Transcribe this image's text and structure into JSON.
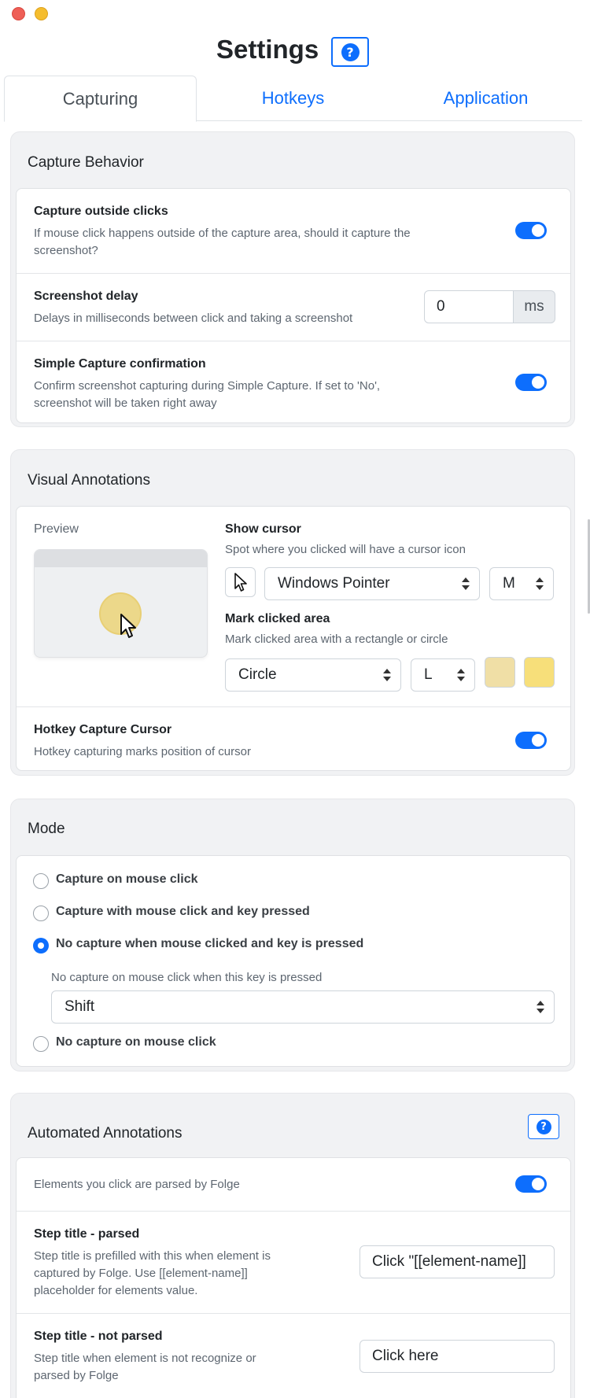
{
  "window": {
    "title": "Settings"
  },
  "tabs": [
    {
      "label": "Capturing",
      "active": true
    },
    {
      "label": "Hotkeys",
      "active": false
    },
    {
      "label": "Application",
      "active": false
    }
  ],
  "help_icon_glyph": "?",
  "capture_behavior": {
    "title": "Capture Behavior",
    "outside_clicks": {
      "title": "Capture outside clicks",
      "desc_line1": "If mouse click happens outside of the capture area, should it capture the",
      "desc_line2": "screenshot?",
      "enabled": true
    },
    "delay": {
      "title": "Screenshot delay",
      "desc": "Delays in milliseconds between click and taking a screenshot",
      "value": "0",
      "unit": "ms"
    },
    "simple_confirm": {
      "title": "Simple Capture confirmation",
      "desc_line1": "Confirm screenshot capturing during Simple Capture. If set to 'No',",
      "desc_line2": "screenshot will be taken right away",
      "enabled": true
    }
  },
  "visual_annotations": {
    "title": "Visual Annotations",
    "preview_label": "Preview",
    "show_cursor": {
      "title": "Show cursor",
      "desc": "Spot where you clicked will have a cursor icon",
      "cursor_type": "Windows Pointer",
      "cursor_size": "M"
    },
    "mark_area": {
      "title": "Mark clicked area",
      "desc": "Mark clicked area with a rectangle or circle",
      "shape": "Circle",
      "size": "L",
      "color_1": "#f0dfa6",
      "color_2": "#f7df7a"
    },
    "hotkey_cursor": {
      "title": "Hotkey Capture Cursor",
      "desc": "Hotkey capturing marks position of cursor",
      "enabled": true
    }
  },
  "mode": {
    "title": "Mode",
    "options": [
      {
        "label": "Capture on mouse click",
        "checked": false
      },
      {
        "label": "Capture with mouse click and key pressed",
        "checked": false
      },
      {
        "label": "No capture when mouse clicked and key is pressed",
        "checked": true
      },
      {
        "label": "No capture on mouse click",
        "checked": false
      }
    ],
    "key_hint": "No capture on mouse click when this key is pressed",
    "key_value": "Shift"
  },
  "automated_annotations": {
    "title": "Automated Annotations",
    "parse_row": {
      "desc": "Elements you click are parsed by Folge",
      "enabled": true
    },
    "parsed": {
      "title": "Step title - parsed",
      "desc_line1": "Step title is prefilled with this when element is",
      "desc_line2": "captured by Folge. Use [[element-name]]",
      "desc_line3": "placeholder for elements value.",
      "value": "Click \"[[element-name]]"
    },
    "not_parsed": {
      "title": "Step title - not parsed",
      "desc_line1": "Step title when element is not recognize or",
      "desc_line2": "parsed by Folge",
      "value": "Click here"
    }
  },
  "colors": {
    "accent": "#0d6efd",
    "section_bg": "#f1f2f4"
  }
}
